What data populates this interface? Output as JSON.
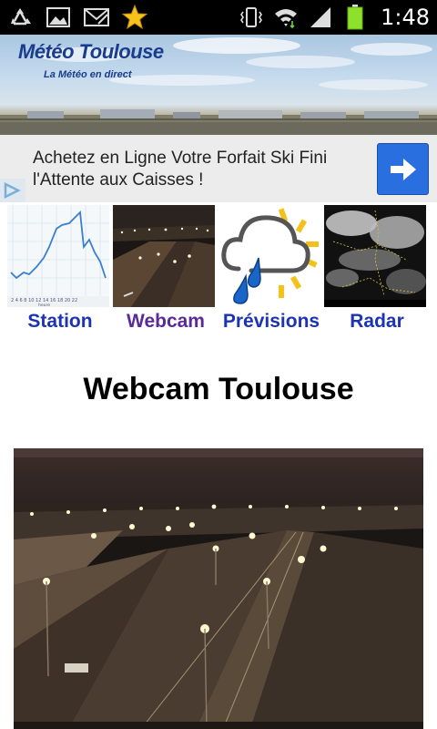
{
  "status_bar": {
    "time": "1:48",
    "left_icons": [
      "recycle-icon",
      "image-icon",
      "mail-icon",
      "star-icon"
    ],
    "right_icons": [
      "vibrate-icon",
      "wifi-icon",
      "signal-icon",
      "battery-icon"
    ]
  },
  "banner": {
    "title": "Météo Toulouse",
    "subtitle": "La Météo en direct"
  },
  "ad": {
    "text": "Achetez en Ligne Votre Forfait Ski Fini l'Attente aux Caisses !",
    "button_icon": "arrow-right-icon"
  },
  "nav": {
    "items": [
      {
        "label": "Station",
        "icon": "station-chart-thumbnail"
      },
      {
        "label": "Webcam",
        "icon": "webcam-thumbnail"
      },
      {
        "label": "Prévisions",
        "icon": "weather-rain-cloud-icon"
      },
      {
        "label": "Radar",
        "icon": "radar-satellite-thumbnail"
      }
    ]
  },
  "page": {
    "title": "Webcam Toulouse"
  },
  "colors": {
    "nav_link": "#1c34b4",
    "nav_active": "#5a2a9a",
    "ad_button": "#2a6fe0",
    "banner_title": "#1a3c8c"
  }
}
